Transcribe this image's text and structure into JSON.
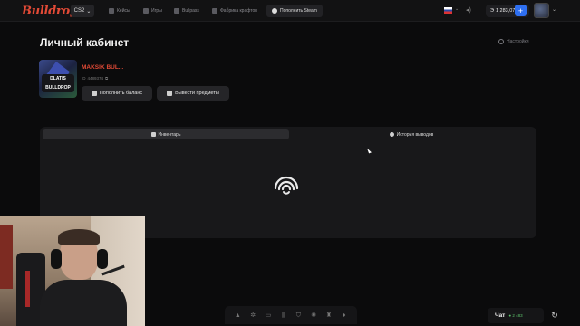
{
  "header": {
    "logo": "Bulldrop",
    "game": "CS2",
    "nav": [
      {
        "label": "Кейсы",
        "icon": "case-icon"
      },
      {
        "label": "Игры",
        "icon": "games-icon"
      },
      {
        "label": "Bullpass",
        "icon": "pass-icon"
      },
      {
        "label": "Фабрика крафтов",
        "icon": "craft-icon"
      }
    ],
    "steam_button": "Пополнить Steam",
    "balance": "1 283,07",
    "currency_icon": "coin-icon"
  },
  "page": {
    "title": "Личный кабинет",
    "settings": "Настройки"
  },
  "profile": {
    "avatar_text": "DLATIS BULLDROP",
    "username": "MAKSIK BUL...",
    "user_id": "4489374",
    "deposit_button": "Пополнить баланс",
    "withdraw_button": "Вывести предметы"
  },
  "tabs": {
    "inventory": "Инвентарь",
    "history": "История выводов"
  },
  "chat": {
    "label": "Чат",
    "online": "2 483"
  },
  "colors": {
    "brand": "#e24a36",
    "accent": "#2e6ff0",
    "online": "#5cc26b"
  }
}
